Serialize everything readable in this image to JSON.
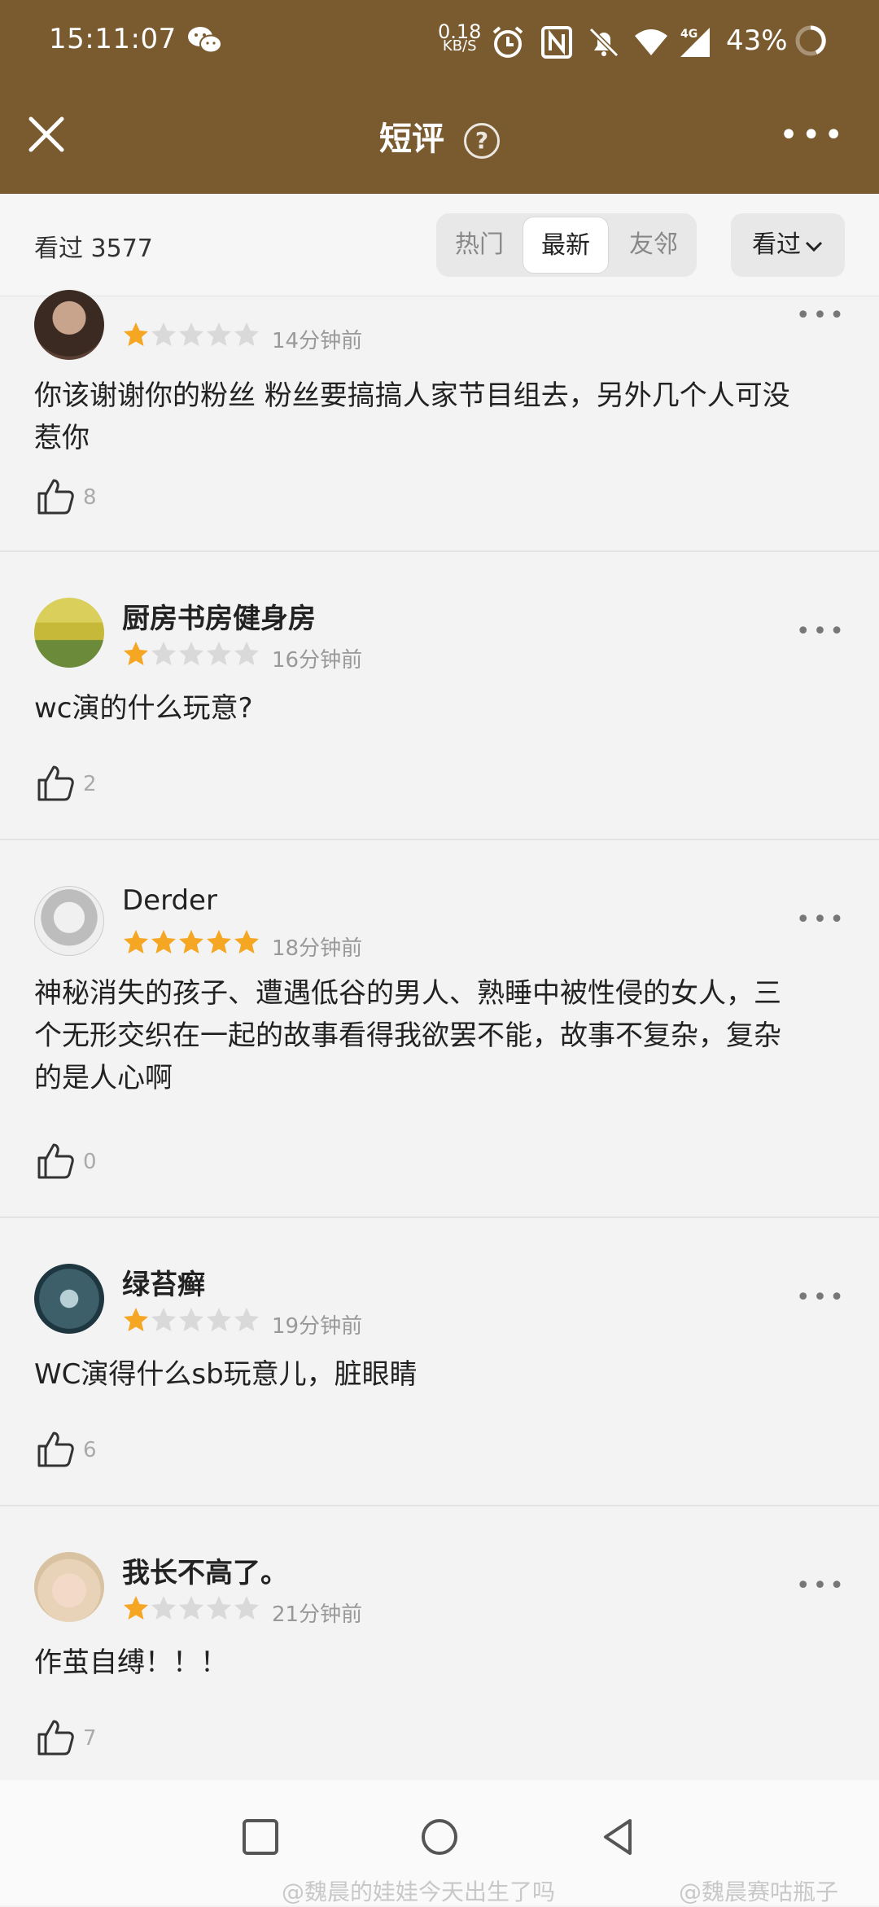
{
  "status_bar": {
    "time": "15:11:07",
    "net_speed_value": "0.18",
    "net_speed_unit": "KB/S",
    "battery_percent": "43%",
    "network_label": "4G"
  },
  "header": {
    "title": "短评",
    "help_glyph": "?",
    "more_glyph": "•••"
  },
  "filter": {
    "seen_label": "看过 3577",
    "tabs": [
      {
        "label": "热门",
        "active": false
      },
      {
        "label": "最新",
        "active": true
      },
      {
        "label": "友邻",
        "active": false
      }
    ],
    "dropdown_label": "看过"
  },
  "comments": [
    {
      "user": "",
      "rating": 1,
      "time": "14分钟前",
      "text_lines": [
        "你该谢谢你的粉丝  粉丝要搞搞人家节目组去，另外几个人可没",
        "惹你"
      ],
      "likes": "8"
    },
    {
      "user": "厨房书房健身房",
      "rating": 1,
      "time": "16分钟前",
      "text_lines": [
        "wc演的什么玩意?"
      ],
      "likes": "2"
    },
    {
      "user": "Derder",
      "rating": 5,
      "time": "18分钟前",
      "text_lines": [
        "神秘消失的孩子、遭遇低谷的男人、熟睡中被性侵的女人，三",
        "个无形交织在一起的故事看得我欲罢不能，故事不复杂，复杂",
        "的是人心啊"
      ],
      "likes": "0"
    },
    {
      "user": "绿苔癣",
      "rating": 1,
      "time": "19分钟前",
      "text_lines": [
        "WC演得什么sb玩意儿，脏眼睛"
      ],
      "likes": "6"
    },
    {
      "user": "我长不高了。",
      "rating": 1,
      "time": "21分钟前",
      "text_lines": [
        "作茧自缚！！！"
      ],
      "likes": "7"
    }
  ],
  "more_glyph": "•••",
  "watermarks": [
    "@魏晨的娃娃今天出生了吗",
    "@魏晨赛咕瓶子"
  ],
  "colors": {
    "header_bg": "#7a5a2f",
    "star_on": "#f5a623",
    "star_off": "#d9d9d9"
  }
}
